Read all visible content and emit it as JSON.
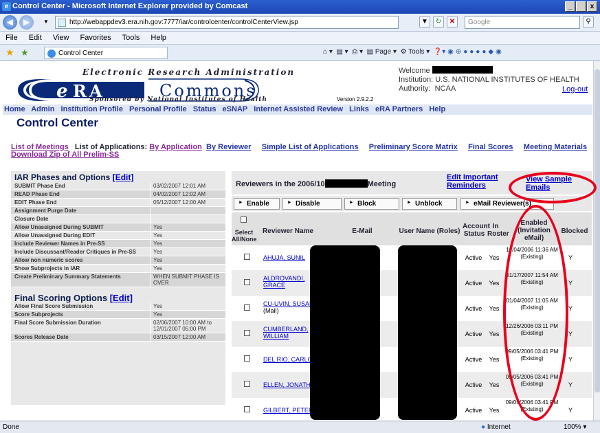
{
  "window": {
    "title": "Control Center - Microsoft Internet Explorer provided by Comcast",
    "minimize": "_",
    "maximize": " ",
    "close": "x"
  },
  "address": {
    "url": "http://webappdev3.era.nih.gov:7777/iar/controlcenter/controlCenterView.jsp",
    "search_placeholder": "Google"
  },
  "menu": [
    "File",
    "Edit",
    "View",
    "Favorites",
    "Tools",
    "Help"
  ],
  "tab": {
    "label": "Control Center"
  },
  "toolbar": {
    "page": "Page",
    "tools": "Tools"
  },
  "header": {
    "top": "Electronic Research Administration",
    "logo_e": "e",
    "logo_ra": "RA",
    "logo_commons": "Commons",
    "sub": "Sponsored by National Institutes of Health",
    "version": "Version 2.9.2.2",
    "welcome": "Welcome",
    "institution_label": "Institution:",
    "institution": "U.S. NATIONAL INSTITUTES OF HEALTH",
    "authority_label": "Authority:",
    "authority": "NCAA",
    "logout": "Log-out"
  },
  "nav": [
    "Home",
    "Admin",
    "Institution Profile",
    "Personal Profile",
    "Status",
    "eSNAP",
    "Internet Assisted Review",
    "Links",
    "eRA Partners",
    "Help"
  ],
  "page_title": "Control Center",
  "links": {
    "meetings": "List of Meetings",
    "apps_label": "List of Applications:",
    "by_app": "By Application",
    "by_reviewer": "By Reviewer",
    "simple": "Simple List of Applications",
    "prelim": "Preliminary Score Matrix",
    "final": "Final Scores",
    "materials": "Meeting Materials",
    "zip": "Download Zip of All Prelim-SS"
  },
  "iar": {
    "title": "IAR Phases and Options",
    "edit": "[Edit]",
    "rows": [
      {
        "k": "SUBMIT Phase End",
        "v": "03/02/2007 12:01 AM"
      },
      {
        "k": "READ Phase End",
        "v": "04/02/2007 12:02 AM"
      },
      {
        "k": "EDIT Phase End",
        "v": "05/12/2007 12:00 AM"
      },
      {
        "k": "Assignment Purge Date",
        "v": ""
      },
      {
        "k": "Closure Date",
        "v": ""
      },
      {
        "k": "Allow Unassigned During SUBMIT",
        "v": "Yes"
      },
      {
        "k": "Allow Unassigned During EDIT",
        "v": "Yes"
      },
      {
        "k": "Include Reviewer Names in Pre-SS",
        "v": "Yes"
      },
      {
        "k": "Include Discussant/Reader Critiques in Pre-SS",
        "v": "Yes"
      },
      {
        "k": "Allow non numeric scores",
        "v": "Yes"
      },
      {
        "k": "Show Subprojects in IAR",
        "v": "Yes"
      },
      {
        "k": "Create Preliminary Summary Statements",
        "v": "WHEN SUBMIT PHASE IS OVER"
      }
    ]
  },
  "final_scoring": {
    "title": "Final Scoring Options",
    "edit": "[Edit]",
    "rows": [
      {
        "k": "Allow Final Score Submission",
        "v": "Yes"
      },
      {
        "k": "Score Subprojects",
        "v": "Yes"
      },
      {
        "k": "Final Score Submission Duration",
        "v": "02/06/2007 10:00 AM to 12/01/2007 05:00 PM"
      },
      {
        "k": "Scores Release Date",
        "v": "03/15/2007 12:00 AM"
      }
    ]
  },
  "reviewers": {
    "title_prefix": "Reviewers in the 2006/10",
    "title_suffix": "Meeting",
    "edit_reminders": "Edit Important Reminders",
    "view_samples": "View Sample Emails",
    "buttons": {
      "enable": "Enable",
      "disable": "Disable",
      "block": "Block",
      "unblock": "Unblock",
      "email": "eMail Reviewer(s)"
    },
    "columns": {
      "select": "Select All/None",
      "name": "Reviewer Name",
      "email": "E-Mail",
      "user": "User Name (Roles)",
      "account": "Account Status",
      "roster": "In Roster",
      "enabled": "Enabled (Invitation eMail)",
      "blocked": "Blocked"
    },
    "rows": [
      {
        "name": "AHUJA, SUNIL",
        "sub": "",
        "status": "Active",
        "roster": "Yes",
        "enabled": "12/04/2006 11:36 AM (Existing)",
        "blocked": "Y"
      },
      {
        "name": "ALDROVANDI, GRACE",
        "sub": "",
        "status": "Active",
        "roster": "Yes",
        "enabled": "01/17/2007 11:54 AM (Existing)",
        "blocked": "Y"
      },
      {
        "name": "CU-UVIN, SUSAN",
        "sub": "(Mail)",
        "status": "Active",
        "roster": "Yes",
        "enabled": "01/04/2007 11:05 AM (Existing)",
        "blocked": "Y"
      },
      {
        "name": "CUMBERLAND, WILLIAM",
        "sub": "",
        "status": "Active",
        "roster": "Yes",
        "enabled": "12/26/2006 03:11 PM (Existing)",
        "blocked": "Y"
      },
      {
        "name": "DEL RIO, CARLOS",
        "sub": "",
        "status": "Active",
        "roster": "Yes",
        "enabled": "09/05/2006 03:41 PM (Existing)",
        "blocked": "Y"
      },
      {
        "name": "ELLEN, JONATHAN",
        "sub": "",
        "status": "Active",
        "roster": "Yes",
        "enabled": "09/05/2006 03:41 PM (Existing)",
        "blocked": "Y"
      },
      {
        "name": "GILBERT, PETER",
        "sub": "",
        "status": "Active",
        "roster": "Yes",
        "enabled": "09/05/2006 03:41 PM (Existing)",
        "blocked": "Y"
      }
    ]
  },
  "status": {
    "left": "Done",
    "zone": "Internet",
    "zoom": "100%"
  }
}
